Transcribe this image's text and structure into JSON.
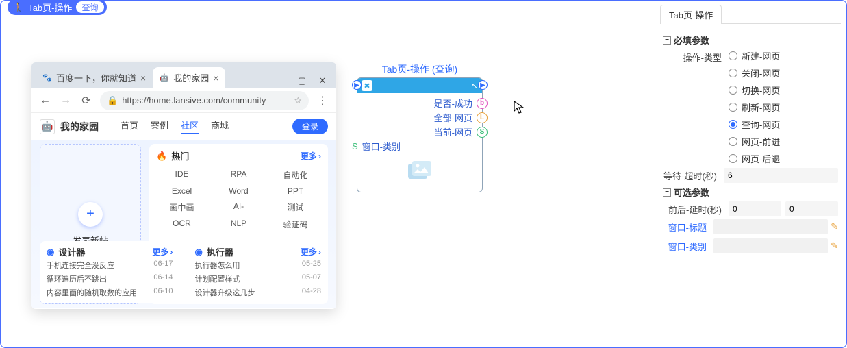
{
  "badge": {
    "title": "Tab页-操作",
    "sub": "查询"
  },
  "browser": {
    "tabs": [
      {
        "label": "百度一下，你就知道"
      },
      {
        "label": "我的家园"
      }
    ],
    "url_text": "https://home.lansive.com/community",
    "site_name": "我的家园",
    "nav": [
      "首页",
      "案例",
      "社区",
      "商城"
    ],
    "nav_active_index": 2,
    "login": "登录",
    "post_btn": "发表新帖",
    "hot": {
      "title": "热门",
      "more": "更多",
      "tags": [
        "IDE",
        "RPA",
        "自动化",
        "Excel",
        "Word",
        "PPT",
        "画中画",
        "AI-",
        "测试",
        "OCR",
        "NLP",
        "验证码"
      ]
    },
    "lists": [
      {
        "title": "设计器",
        "more": "更多",
        "items": [
          {
            "t": "手机连接完全没反应",
            "d": "06-17"
          },
          {
            "t": "循环遍历后不跳出",
            "d": "06-14"
          },
          {
            "t": "内容里面的随机取数的应用",
            "d": "06-10"
          }
        ]
      },
      {
        "title": "执行器",
        "more": "更多",
        "items": [
          {
            "t": "执行器怎么用",
            "d": "05-25"
          },
          {
            "t": "计划配置样式",
            "d": "05-07"
          },
          {
            "t": "设计器升级这几步",
            "d": "04-28"
          }
        ]
      }
    ]
  },
  "node": {
    "title": "Tab页-操作 (查询)",
    "outputs": [
      {
        "label": "是否-成功",
        "port": "b"
      },
      {
        "label": "全部-网页",
        "port": "L"
      },
      {
        "label": "当前-网页",
        "port": "S"
      }
    ],
    "input": {
      "label": "窗口-类别",
      "port": "S"
    }
  },
  "panel": {
    "tab": "Tab页-操作",
    "required_header": "必填参数",
    "op_type_label": "操作-类型",
    "op_type_options": [
      "新建-网页",
      "关闭-网页",
      "切换-网页",
      "刷新-网页",
      "查询-网页",
      "网页-前进",
      "网页-后退"
    ],
    "op_type_selected": "查询-网页",
    "wait_label": "等待-超时(秒)",
    "wait_value": "6",
    "optional_header": "可选参数",
    "delay_label": "前后-延时(秒)",
    "delay_a": "0",
    "delay_b": "0",
    "opt1_label": "窗口-标题",
    "opt2_label": "窗口-类别"
  }
}
